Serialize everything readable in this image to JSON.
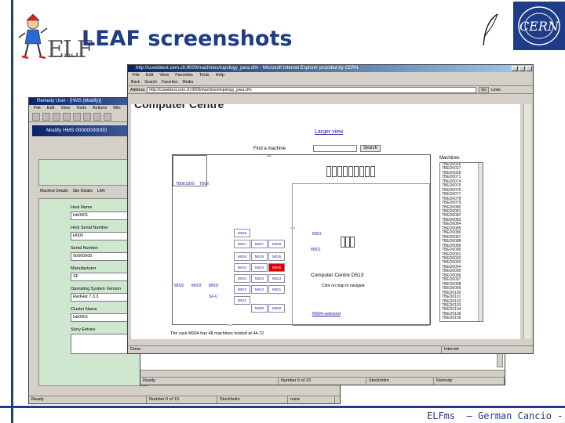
{
  "slide": {
    "title": "LEAF screenshots",
    "footer": "ELFms  – German Cancio - n° 20",
    "logo_small": "ELF",
    "logo_small_sub": "ms",
    "cern_logo": "CERN",
    "colors": {
      "brand": "#1f3c88"
    }
  },
  "remedy_window": {
    "title": "Remedy User - [HMS (Modify)]",
    "menu": [
      "File",
      "Edit",
      "View",
      "Tools",
      "Actions",
      "Win"
    ],
    "form_title": "Modify HMS 00000000000",
    "tabs": [
      "Machine Details",
      "Site Details",
      "LAN"
    ],
    "fields": [
      {
        "label": "Host Name",
        "value": "lxb0001"
      },
      {
        "label": "Host Serial Number",
        "value": "H000"
      },
      {
        "label": "Serial Number",
        "value": "00000000"
      },
      {
        "label": "Manufacturer",
        "value": "SF"
      },
      {
        "label": "Operating System Version",
        "value": "RedHat 7.3.3"
      },
      {
        "label": "Cluster Name",
        "value": "lxb0001"
      }
    ],
    "history_label": "Story Entries",
    "status": [
      "Ready",
      "Number 6 of 13",
      "Stockholm",
      "none"
    ]
  },
  "mid_window": {
    "status": [
      "Ready",
      "Number 6 of 13",
      "Stockholm",
      "Remedy"
    ]
  },
  "ie_window": {
    "title": "http://ccwebtest.cern.ch:9000/machines/topology_para.cfm - Microsoft Internet Explorer provided by CERN",
    "menu": [
      "File",
      "Edit",
      "View",
      "Favorites",
      "Tools",
      "Help"
    ],
    "toolbar": [
      "Back",
      "Search",
      "Favorites",
      "Media"
    ],
    "address_label": "Address",
    "address": "http://ccwebtest.cern.ch:9000/machines/topology_para.cfm",
    "go": "Go",
    "links": "Links",
    "page_heading": "Computer Centre",
    "larger_link": "Larger view",
    "search_label": "Find a machine",
    "search_button": "Search",
    "machines_label": "Machines",
    "machines": [
      "TBED0026",
      "TBED0027",
      "TBED0028",
      "TBED0071",
      "TBED0074",
      "TBED0075",
      "TBED0076",
      "TBED0077",
      "TBED0078",
      "TBED0079",
      "TBED0080",
      "TBED0081",
      "TBED0082",
      "TBED0083",
      "TBED0084",
      "TBED0085",
      "TBED0086",
      "TBED0087",
      "TBED0088",
      "TBED0089",
      "TBED0090",
      "TBED0091",
      "TBED0092",
      "TBED0093",
      "TBED0094",
      "TBED0095",
      "TBED0096",
      "TBED0097",
      "TBED0098",
      "TBED0099",
      "TBED0100",
      "TBED0101",
      "TBED0102",
      "TBED0103",
      "TBED0104",
      "TBED0105",
      "TBED0106"
    ],
    "plan": {
      "top_labels": [
        "TB0E1890",
        "TB0E"
      ],
      "cells": [
        "M028",
        "M027",
        "M027",
        "M026",
        "M026",
        "M025",
        "M025",
        "M024",
        "M024",
        "M026",
        "M024",
        "M023",
        "M023",
        "M022",
        "M022",
        "M021",
        "M021",
        "M000",
        "M000"
      ],
      "left_labels": [
        "M002",
        "M003",
        "M002"
      ],
      "small_label": "SF-U",
      "right_labels": [
        "B901",
        "M901"
      ],
      "room_title": "Computer Centre D513",
      "room_note": "Click on map to navigate",
      "selected": "M004 selected"
    },
    "caption": "The rack M004 has 48 machines hosted at 44.72",
    "status": [
      "Done",
      "Internet"
    ]
  }
}
